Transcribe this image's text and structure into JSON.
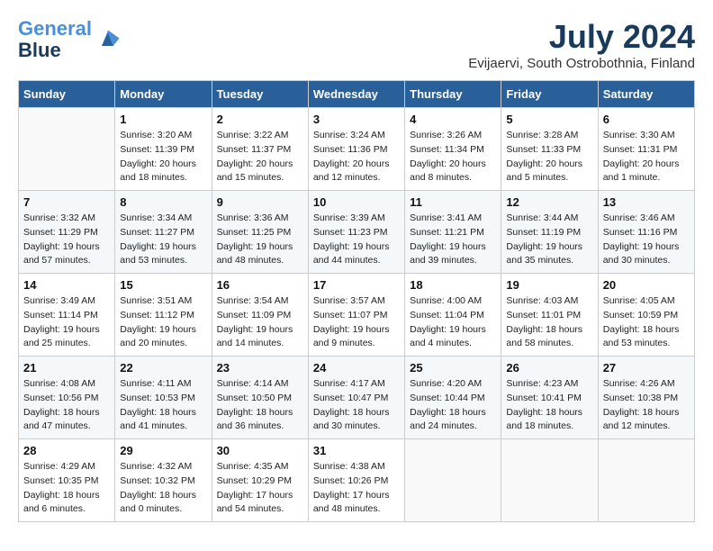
{
  "header": {
    "logo_line1": "General",
    "logo_line2": "Blue",
    "month_year": "July 2024",
    "location": "Evijaervi, South Ostrobothnia, Finland"
  },
  "weekdays": [
    "Sunday",
    "Monday",
    "Tuesday",
    "Wednesday",
    "Thursday",
    "Friday",
    "Saturday"
  ],
  "weeks": [
    [
      {
        "day": "",
        "info": ""
      },
      {
        "day": "1",
        "info": "Sunrise: 3:20 AM\nSunset: 11:39 PM\nDaylight: 20 hours\nand 18 minutes."
      },
      {
        "day": "2",
        "info": "Sunrise: 3:22 AM\nSunset: 11:37 PM\nDaylight: 20 hours\nand 15 minutes."
      },
      {
        "day": "3",
        "info": "Sunrise: 3:24 AM\nSunset: 11:36 PM\nDaylight: 20 hours\nand 12 minutes."
      },
      {
        "day": "4",
        "info": "Sunrise: 3:26 AM\nSunset: 11:34 PM\nDaylight: 20 hours\nand 8 minutes."
      },
      {
        "day": "5",
        "info": "Sunrise: 3:28 AM\nSunset: 11:33 PM\nDaylight: 20 hours\nand 5 minutes."
      },
      {
        "day": "6",
        "info": "Sunrise: 3:30 AM\nSunset: 11:31 PM\nDaylight: 20 hours\nand 1 minute."
      }
    ],
    [
      {
        "day": "7",
        "info": "Sunrise: 3:32 AM\nSunset: 11:29 PM\nDaylight: 19 hours\nand 57 minutes."
      },
      {
        "day": "8",
        "info": "Sunrise: 3:34 AM\nSunset: 11:27 PM\nDaylight: 19 hours\nand 53 minutes."
      },
      {
        "day": "9",
        "info": "Sunrise: 3:36 AM\nSunset: 11:25 PM\nDaylight: 19 hours\nand 48 minutes."
      },
      {
        "day": "10",
        "info": "Sunrise: 3:39 AM\nSunset: 11:23 PM\nDaylight: 19 hours\nand 44 minutes."
      },
      {
        "day": "11",
        "info": "Sunrise: 3:41 AM\nSunset: 11:21 PM\nDaylight: 19 hours\nand 39 minutes."
      },
      {
        "day": "12",
        "info": "Sunrise: 3:44 AM\nSunset: 11:19 PM\nDaylight: 19 hours\nand 35 minutes."
      },
      {
        "day": "13",
        "info": "Sunrise: 3:46 AM\nSunset: 11:16 PM\nDaylight: 19 hours\nand 30 minutes."
      }
    ],
    [
      {
        "day": "14",
        "info": "Sunrise: 3:49 AM\nSunset: 11:14 PM\nDaylight: 19 hours\nand 25 minutes."
      },
      {
        "day": "15",
        "info": "Sunrise: 3:51 AM\nSunset: 11:12 PM\nDaylight: 19 hours\nand 20 minutes."
      },
      {
        "day": "16",
        "info": "Sunrise: 3:54 AM\nSunset: 11:09 PM\nDaylight: 19 hours\nand 14 minutes."
      },
      {
        "day": "17",
        "info": "Sunrise: 3:57 AM\nSunset: 11:07 PM\nDaylight: 19 hours\nand 9 minutes."
      },
      {
        "day": "18",
        "info": "Sunrise: 4:00 AM\nSunset: 11:04 PM\nDaylight: 19 hours\nand 4 minutes."
      },
      {
        "day": "19",
        "info": "Sunrise: 4:03 AM\nSunset: 11:01 PM\nDaylight: 18 hours\nand 58 minutes."
      },
      {
        "day": "20",
        "info": "Sunrise: 4:05 AM\nSunset: 10:59 PM\nDaylight: 18 hours\nand 53 minutes."
      }
    ],
    [
      {
        "day": "21",
        "info": "Sunrise: 4:08 AM\nSunset: 10:56 PM\nDaylight: 18 hours\nand 47 minutes."
      },
      {
        "day": "22",
        "info": "Sunrise: 4:11 AM\nSunset: 10:53 PM\nDaylight: 18 hours\nand 41 minutes."
      },
      {
        "day": "23",
        "info": "Sunrise: 4:14 AM\nSunset: 10:50 PM\nDaylight: 18 hours\nand 36 minutes."
      },
      {
        "day": "24",
        "info": "Sunrise: 4:17 AM\nSunset: 10:47 PM\nDaylight: 18 hours\nand 30 minutes."
      },
      {
        "day": "25",
        "info": "Sunrise: 4:20 AM\nSunset: 10:44 PM\nDaylight: 18 hours\nand 24 minutes."
      },
      {
        "day": "26",
        "info": "Sunrise: 4:23 AM\nSunset: 10:41 PM\nDaylight: 18 hours\nand 18 minutes."
      },
      {
        "day": "27",
        "info": "Sunrise: 4:26 AM\nSunset: 10:38 PM\nDaylight: 18 hours\nand 12 minutes."
      }
    ],
    [
      {
        "day": "28",
        "info": "Sunrise: 4:29 AM\nSunset: 10:35 PM\nDaylight: 18 hours\nand 6 minutes."
      },
      {
        "day": "29",
        "info": "Sunrise: 4:32 AM\nSunset: 10:32 PM\nDaylight: 18 hours\nand 0 minutes."
      },
      {
        "day": "30",
        "info": "Sunrise: 4:35 AM\nSunset: 10:29 PM\nDaylight: 17 hours\nand 54 minutes."
      },
      {
        "day": "31",
        "info": "Sunrise: 4:38 AM\nSunset: 10:26 PM\nDaylight: 17 hours\nand 48 minutes."
      },
      {
        "day": "",
        "info": ""
      },
      {
        "day": "",
        "info": ""
      },
      {
        "day": "",
        "info": ""
      }
    ]
  ]
}
